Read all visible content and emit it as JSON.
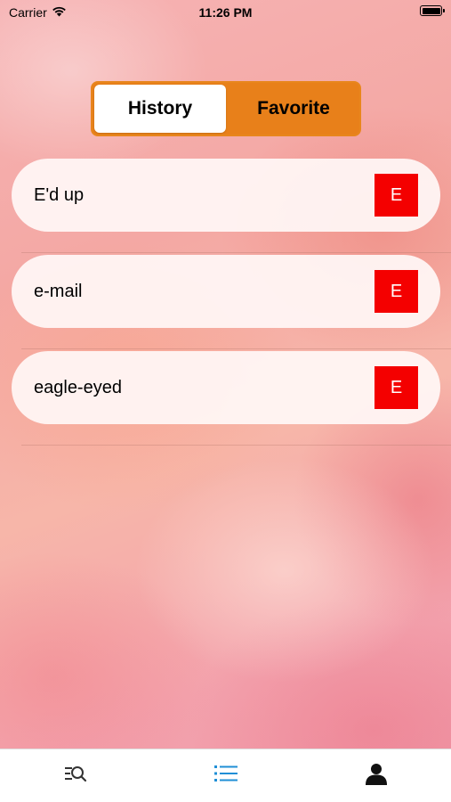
{
  "status_bar": {
    "carrier": "Carrier",
    "time": "11:26 PM",
    "icons": [
      "wifi-icon",
      "battery-icon"
    ]
  },
  "segmented": {
    "options": [
      "History",
      "Favorite"
    ],
    "selected": "History",
    "accent_color": "#e8801a"
  },
  "list": {
    "items": [
      {
        "label": "E'd up",
        "badge": "E"
      },
      {
        "label": "e-mail",
        "badge": "E"
      },
      {
        "label": "eagle-eyed",
        "badge": "E"
      }
    ],
    "badge_color": "#f40000"
  },
  "tab_bar": {
    "tabs": [
      {
        "icon": "search-list-icon",
        "active": false
      },
      {
        "icon": "list-icon",
        "active": true
      },
      {
        "icon": "person-icon",
        "active": false
      }
    ],
    "active_color": "#1f8fd6",
    "inactive_color": "#333333"
  }
}
